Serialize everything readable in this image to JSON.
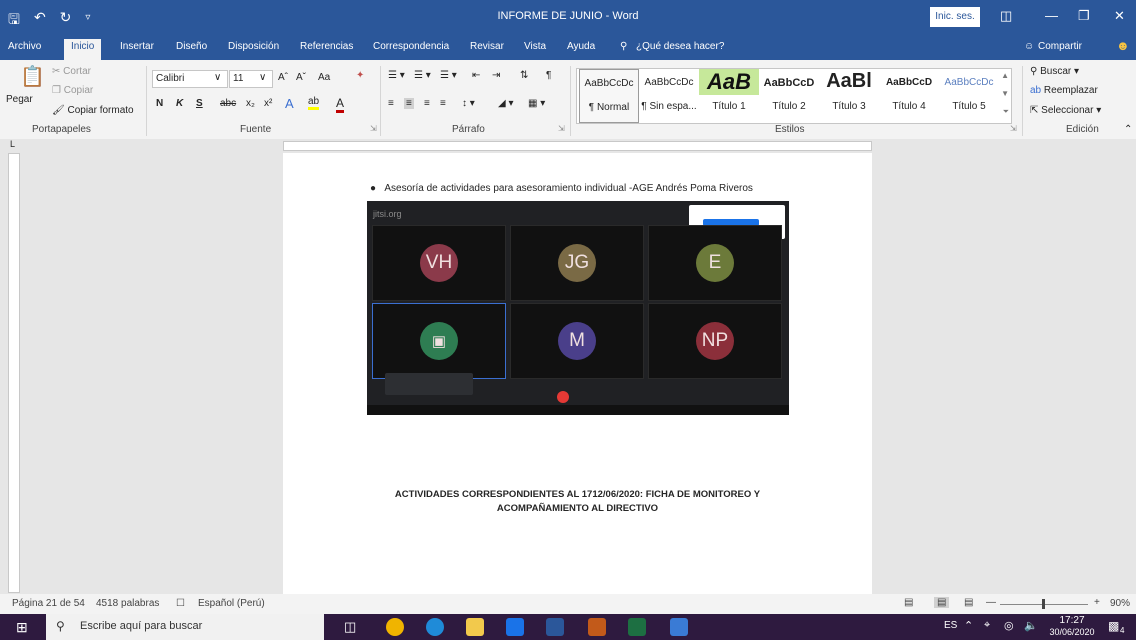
{
  "window": {
    "title": "INFORME DE JUNIO  -  Word",
    "signin": "Inic. ses."
  },
  "tabs": [
    "Archivo",
    "Inicio",
    "Insertar",
    "Diseño",
    "Disposición",
    "Referencias",
    "Correspondencia",
    "Revisar",
    "Vista",
    "Ayuda"
  ],
  "tell_me": "¿Qué desea hacer?",
  "share": "Compartir",
  "clipboard": {
    "paste": "Pegar",
    "cut": "Cortar",
    "copy": "Copiar",
    "format_painter": "Copiar formato",
    "group": "Portapapeles"
  },
  "font": {
    "name": "Calibri",
    "size": "11",
    "group": "Fuente",
    "bold": "N",
    "italic": "K",
    "underline": "S",
    "strike": "abc",
    "sub": "x₂",
    "sup": "x²",
    "case": "Aa"
  },
  "paragraph": {
    "group": "Párrafo"
  },
  "styles": {
    "group": "Estilos",
    "items": [
      {
        "sample": "AaBbCcDc",
        "name": "¶ Normal"
      },
      {
        "sample": "AaBbCcDc",
        "name": "¶ Sin espa..."
      },
      {
        "sample": "AaB",
        "name": "Título 1"
      },
      {
        "sample": "AaBbCcD",
        "name": "Título 2"
      },
      {
        "sample": "AaBl",
        "name": "Título 3"
      },
      {
        "sample": "AaBbCcD",
        "name": "Título 4"
      },
      {
        "sample": "AaBbCcDc",
        "name": "Título 5"
      }
    ]
  },
  "editing": {
    "search": "Buscar",
    "replace": "Reemplazar",
    "select": "Seleccionar",
    "group": "Edición"
  },
  "document": {
    "bullet_text": "Asesoría de actividades para asesoramiento individual -AGE Andrés Poma Riveros",
    "meeting": {
      "logo": "jitsi.org",
      "participants": [
        {
          "initials": "VH",
          "color": "#8b3a4a"
        },
        {
          "initials": "JG",
          "color": "#7a6a45"
        },
        {
          "initials": "E",
          "color": "#6c7a3a"
        },
        {
          "initials": "",
          "color": "#2e7d52"
        },
        {
          "initials": "M",
          "color": "#4a3f8a"
        },
        {
          "initials": "NP",
          "color": "#8b2f3a"
        }
      ]
    },
    "heading_line1": "ACTIVIDADES CORRESPONDIENTES AL 1712/06/2020: FICHA DE  MONITOREO Y",
    "heading_line2": "ACOMPAÑAMIENTO  AL DIRECTIVO"
  },
  "status": {
    "page": "Página 21 de 54",
    "words": "4518 palabras",
    "language": "Español (Perú)",
    "zoom": "90%"
  },
  "taskbar": {
    "search_placeholder": "Escribe aquí para buscar",
    "lang": "ES",
    "time": "17:27",
    "date": "30/06/2020",
    "notif": "4"
  }
}
